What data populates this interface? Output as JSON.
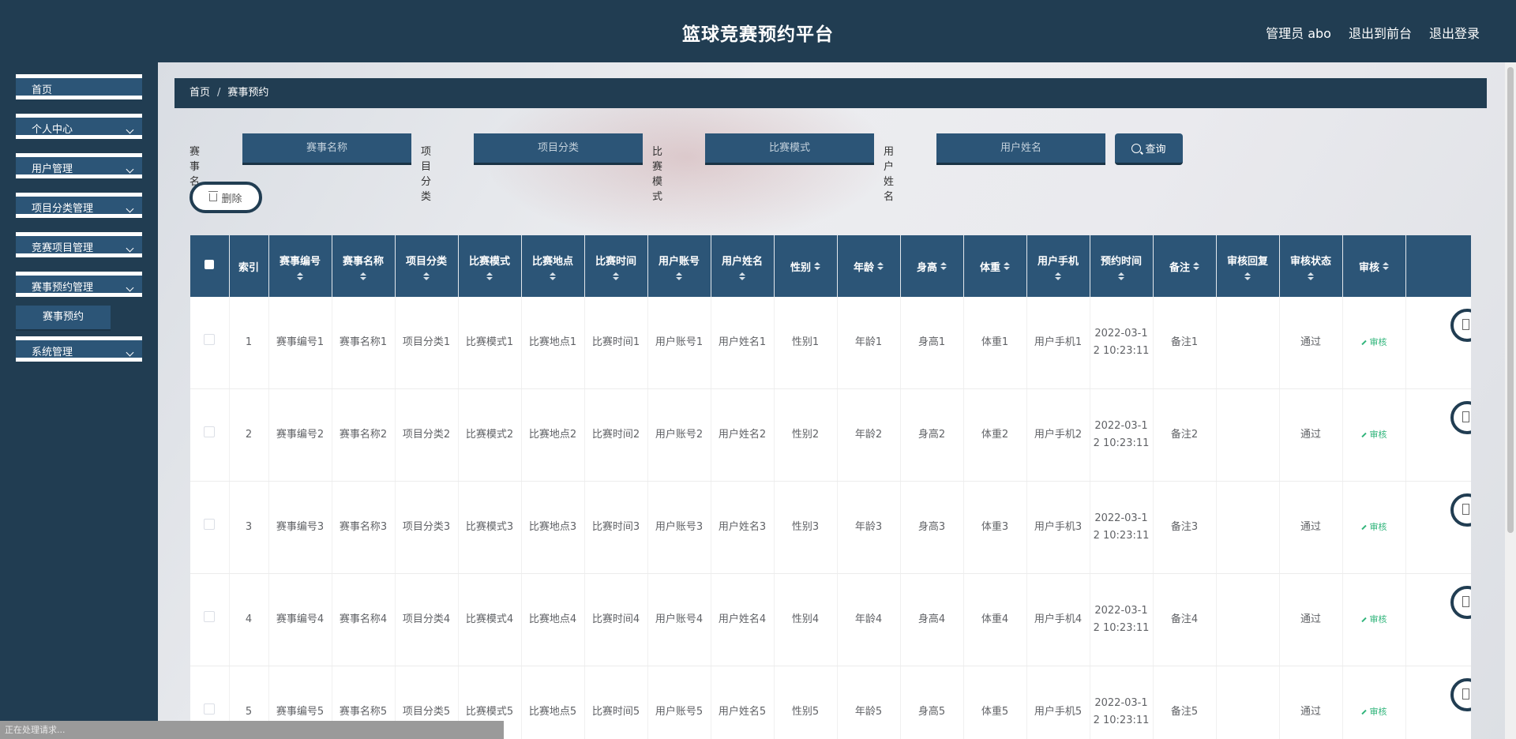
{
  "header": {
    "title": "篮球竞赛预约平台",
    "admin_label": "管理员 abo",
    "to_frontend": "退出到前台",
    "logout": "退出登录"
  },
  "sidebar": {
    "items": [
      {
        "label": "首页"
      },
      {
        "label": "个人中心"
      },
      {
        "label": "用户管理"
      },
      {
        "label": "项目分类管理"
      },
      {
        "label": "竞赛项目管理"
      },
      {
        "label": "赛事预约管理"
      },
      {
        "label": "系统管理"
      }
    ],
    "submenu_label": "赛事预约"
  },
  "breadcrumb": {
    "home": "首页",
    "separator": "/",
    "current": "赛事预约"
  },
  "search": {
    "name_label": "赛事名称",
    "name_placeholder": "赛事名称",
    "category_label": "项目分类",
    "category_placeholder": "项目分类",
    "mode_label": "比赛模式",
    "mode_placeholder": "比赛模式",
    "user_label": "用户姓名",
    "user_placeholder": "用户姓名",
    "search_button": "查询"
  },
  "delete_button": "删除",
  "table": {
    "headers": [
      "索引",
      "赛事编号",
      "赛事名称",
      "项目分类",
      "比赛模式",
      "比赛地点",
      "比赛时间",
      "用户账号",
      "用户姓名",
      "性别",
      "年龄",
      "身高",
      "体重",
      "用户手机",
      "预约时间",
      "备注",
      "审核回复",
      "审核状态",
      "审核"
    ],
    "rows": [
      {
        "index": "1",
        "event_no": "赛事编号1",
        "event_name": "赛事名称1",
        "category": "项目分类1",
        "mode": "比赛模式1",
        "place": "比赛地点1",
        "time": "比赛时间1",
        "account": "用户账号1",
        "user_name": "用户姓名1",
        "gender": "性别1",
        "age": "年龄1",
        "height": "身高1",
        "weight": "体重1",
        "phone": "用户手机1",
        "booking_time": "2022-03-12 10:23:11",
        "remark": "备注1",
        "reply": "",
        "status": "通过",
        "audit": "审核"
      },
      {
        "index": "2",
        "event_no": "赛事编号2",
        "event_name": "赛事名称2",
        "category": "项目分类2",
        "mode": "比赛模式2",
        "place": "比赛地点2",
        "time": "比赛时间2",
        "account": "用户账号2",
        "user_name": "用户姓名2",
        "gender": "性别2",
        "age": "年龄2",
        "height": "身高2",
        "weight": "体重2",
        "phone": "用户手机2",
        "booking_time": "2022-03-12 10:23:11",
        "remark": "备注2",
        "reply": "",
        "status": "通过",
        "audit": "审核"
      },
      {
        "index": "3",
        "event_no": "赛事编号3",
        "event_name": "赛事名称3",
        "category": "项目分类3",
        "mode": "比赛模式3",
        "place": "比赛地点3",
        "time": "比赛时间3",
        "account": "用户账号3",
        "user_name": "用户姓名3",
        "gender": "性别3",
        "age": "年龄3",
        "height": "身高3",
        "weight": "体重3",
        "phone": "用户手机3",
        "booking_time": "2022-03-12 10:23:11",
        "remark": "备注3",
        "reply": "",
        "status": "通过",
        "audit": "审核"
      },
      {
        "index": "4",
        "event_no": "赛事编号4",
        "event_name": "赛事名称4",
        "category": "项目分类4",
        "mode": "比赛模式4",
        "place": "比赛地点4",
        "time": "比赛时间4",
        "account": "用户账号4",
        "user_name": "用户姓名4",
        "gender": "性别4",
        "age": "年龄4",
        "height": "身高4",
        "weight": "体重4",
        "phone": "用户手机4",
        "booking_time": "2022-03-12 10:23:11",
        "remark": "备注4",
        "reply": "",
        "status": "通过",
        "audit": "审核"
      },
      {
        "index": "5",
        "event_no": "赛事编号5",
        "event_name": "赛事名称5",
        "category": "项目分类5",
        "mode": "比赛模式5",
        "place": "比赛地点5",
        "time": "比赛时间5",
        "account": "用户账号5",
        "user_name": "用户姓名5",
        "gender": "性别5",
        "age": "年龄5",
        "height": "身高5",
        "weight": "体重5",
        "phone": "用户手机5",
        "booking_time": "2022-03-12 10:23:11",
        "remark": "备注5",
        "reply": "",
        "status": "通过",
        "audit": "审核"
      }
    ]
  },
  "status_bar": "正在处理请求...",
  "colors": {
    "header_bg": "#213d52",
    "accent": "#2c5577",
    "audit_green": "#2fb47a"
  }
}
